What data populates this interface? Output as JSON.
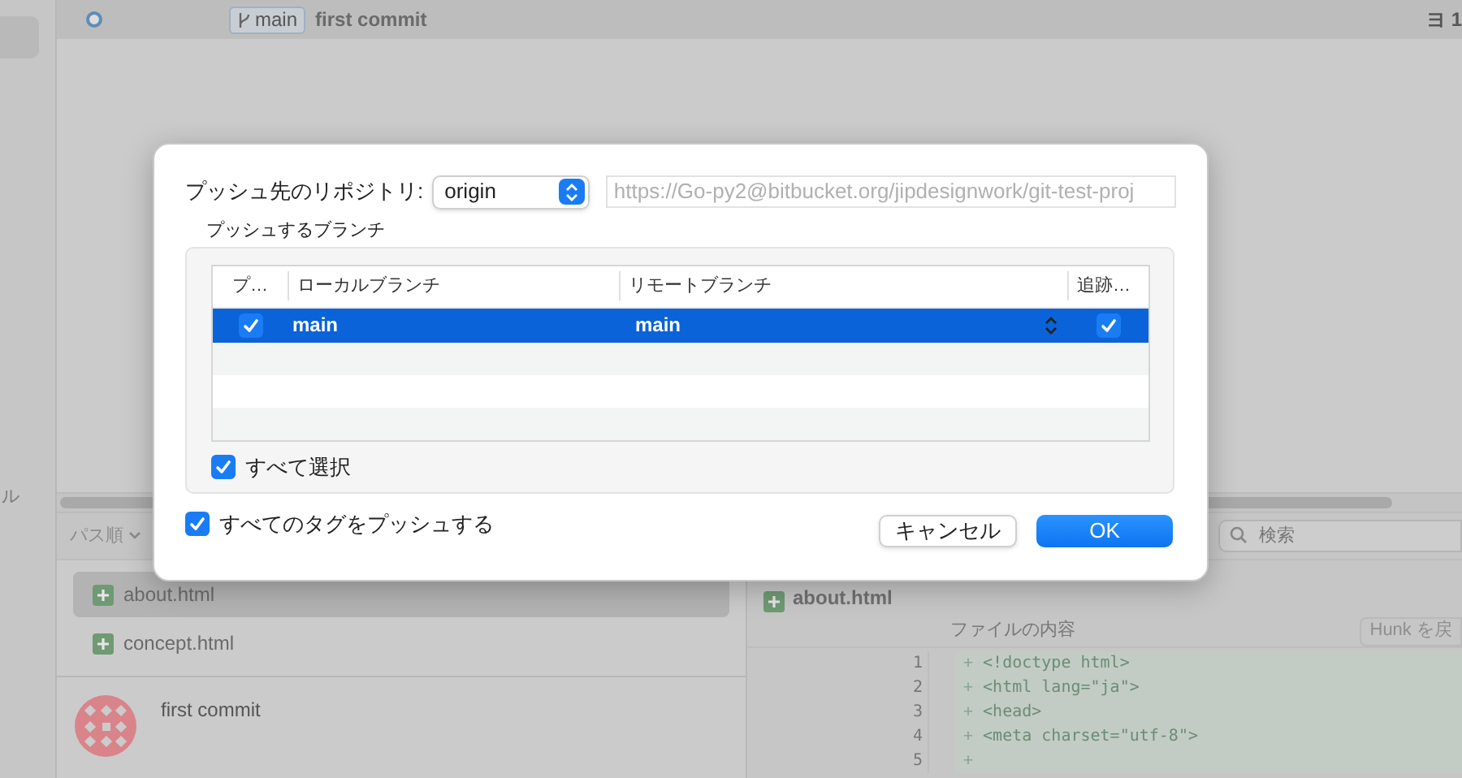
{
  "background": {
    "commit_row": {
      "branch": "main",
      "message": "first commit",
      "column_3": "ヨ 1"
    },
    "sidebar_fragment": "ル",
    "file_list": {
      "sort_label": "パス順",
      "files": [
        {
          "name": "about.html",
          "selected": true
        },
        {
          "name": "concept.html",
          "selected": false
        }
      ]
    },
    "commit_detail": {
      "message": "first commit"
    },
    "search": {
      "placeholder": "検索"
    },
    "diff": {
      "file": "about.html",
      "header": "ファイルの内容",
      "hunk_button": "Hunk を戻",
      "lines": [
        {
          "number": "1",
          "sign": "+",
          "text": "<!doctype html>"
        },
        {
          "number": "2",
          "sign": "+",
          "text": "<html lang=\"ja\">"
        },
        {
          "number": "3",
          "sign": "+",
          "text": "<head>"
        },
        {
          "number": "4",
          "sign": "+",
          "text": "<meta charset=\"utf-8\">"
        },
        {
          "number": "5",
          "sign": "+"
        }
      ]
    }
  },
  "dialog": {
    "repository_label": "プッシュ先のリポジトリ:",
    "repository": "origin",
    "url": "https://Go-py2@bitbucket.org/jipdesignwork/git-test-proj",
    "branches_label": "プッシュするブランチ",
    "columns": [
      "プ…",
      "ローカルブランチ",
      "リモートブランチ",
      "追跡…"
    ],
    "rows": [
      {
        "push": true,
        "local": "main",
        "remote": "main",
        "track": true,
        "selected": true
      }
    ],
    "select_all": {
      "label": "すべて選択",
      "checked": true
    },
    "push_tags": {
      "label": "すべてのタグをプッシュする",
      "checked": true
    },
    "buttons": [
      {
        "label": "キャンセル",
        "kind": "secondary"
      },
      {
        "label": "OK",
        "kind": "primary"
      }
    ]
  }
}
